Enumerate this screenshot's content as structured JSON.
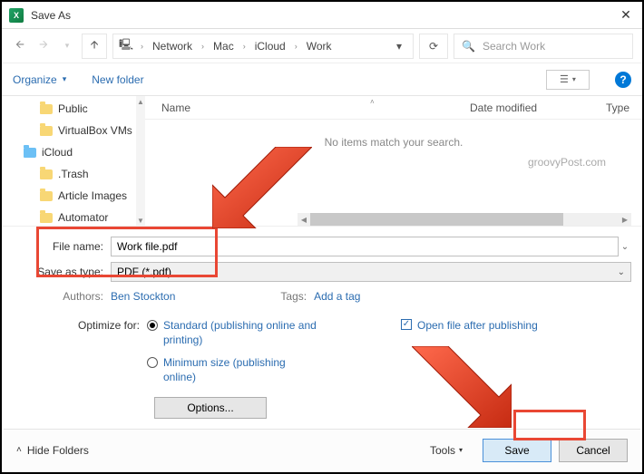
{
  "titlebar": {
    "title": "Save As"
  },
  "address": {
    "crumbs": [
      "Network",
      "Mac",
      "iCloud",
      "Work"
    ]
  },
  "search": {
    "placeholder": "Search Work"
  },
  "toolbar": {
    "organize": "Organize",
    "new_folder": "New folder"
  },
  "tree": {
    "items": [
      {
        "label": "Public",
        "level": 1,
        "cloud": false
      },
      {
        "label": "VirtualBox VMs",
        "level": 1,
        "cloud": false
      },
      {
        "label": "iCloud",
        "level": 0,
        "cloud": true
      },
      {
        "label": ".Trash",
        "level": 1,
        "cloud": false
      },
      {
        "label": "Article Images",
        "level": 1,
        "cloud": false
      },
      {
        "label": "Automator",
        "level": 1,
        "cloud": false
      }
    ]
  },
  "columns": {
    "name": "Name",
    "date": "Date modified",
    "type": "Type"
  },
  "empty_text": "No items match your search.",
  "watermark": "groovyPost.com",
  "form": {
    "file_name_label": "File name:",
    "file_name_value": "Work file.pdf",
    "save_type_label": "Save as type:",
    "save_type_value": "PDF (*.pdf)",
    "authors_label": "Authors:",
    "authors_value": "Ben Stockton",
    "tags_label": "Tags:",
    "tags_value": "Add a tag"
  },
  "optimize": {
    "label": "Optimize for:",
    "standard": "Standard (publishing online and printing)",
    "minimum": "Minimum size (publishing online)",
    "open_after": "Open file after publishing",
    "options_btn": "Options..."
  },
  "bottom": {
    "hide_folders": "Hide Folders",
    "tools": "Tools",
    "save": "Save",
    "cancel": "Cancel"
  }
}
